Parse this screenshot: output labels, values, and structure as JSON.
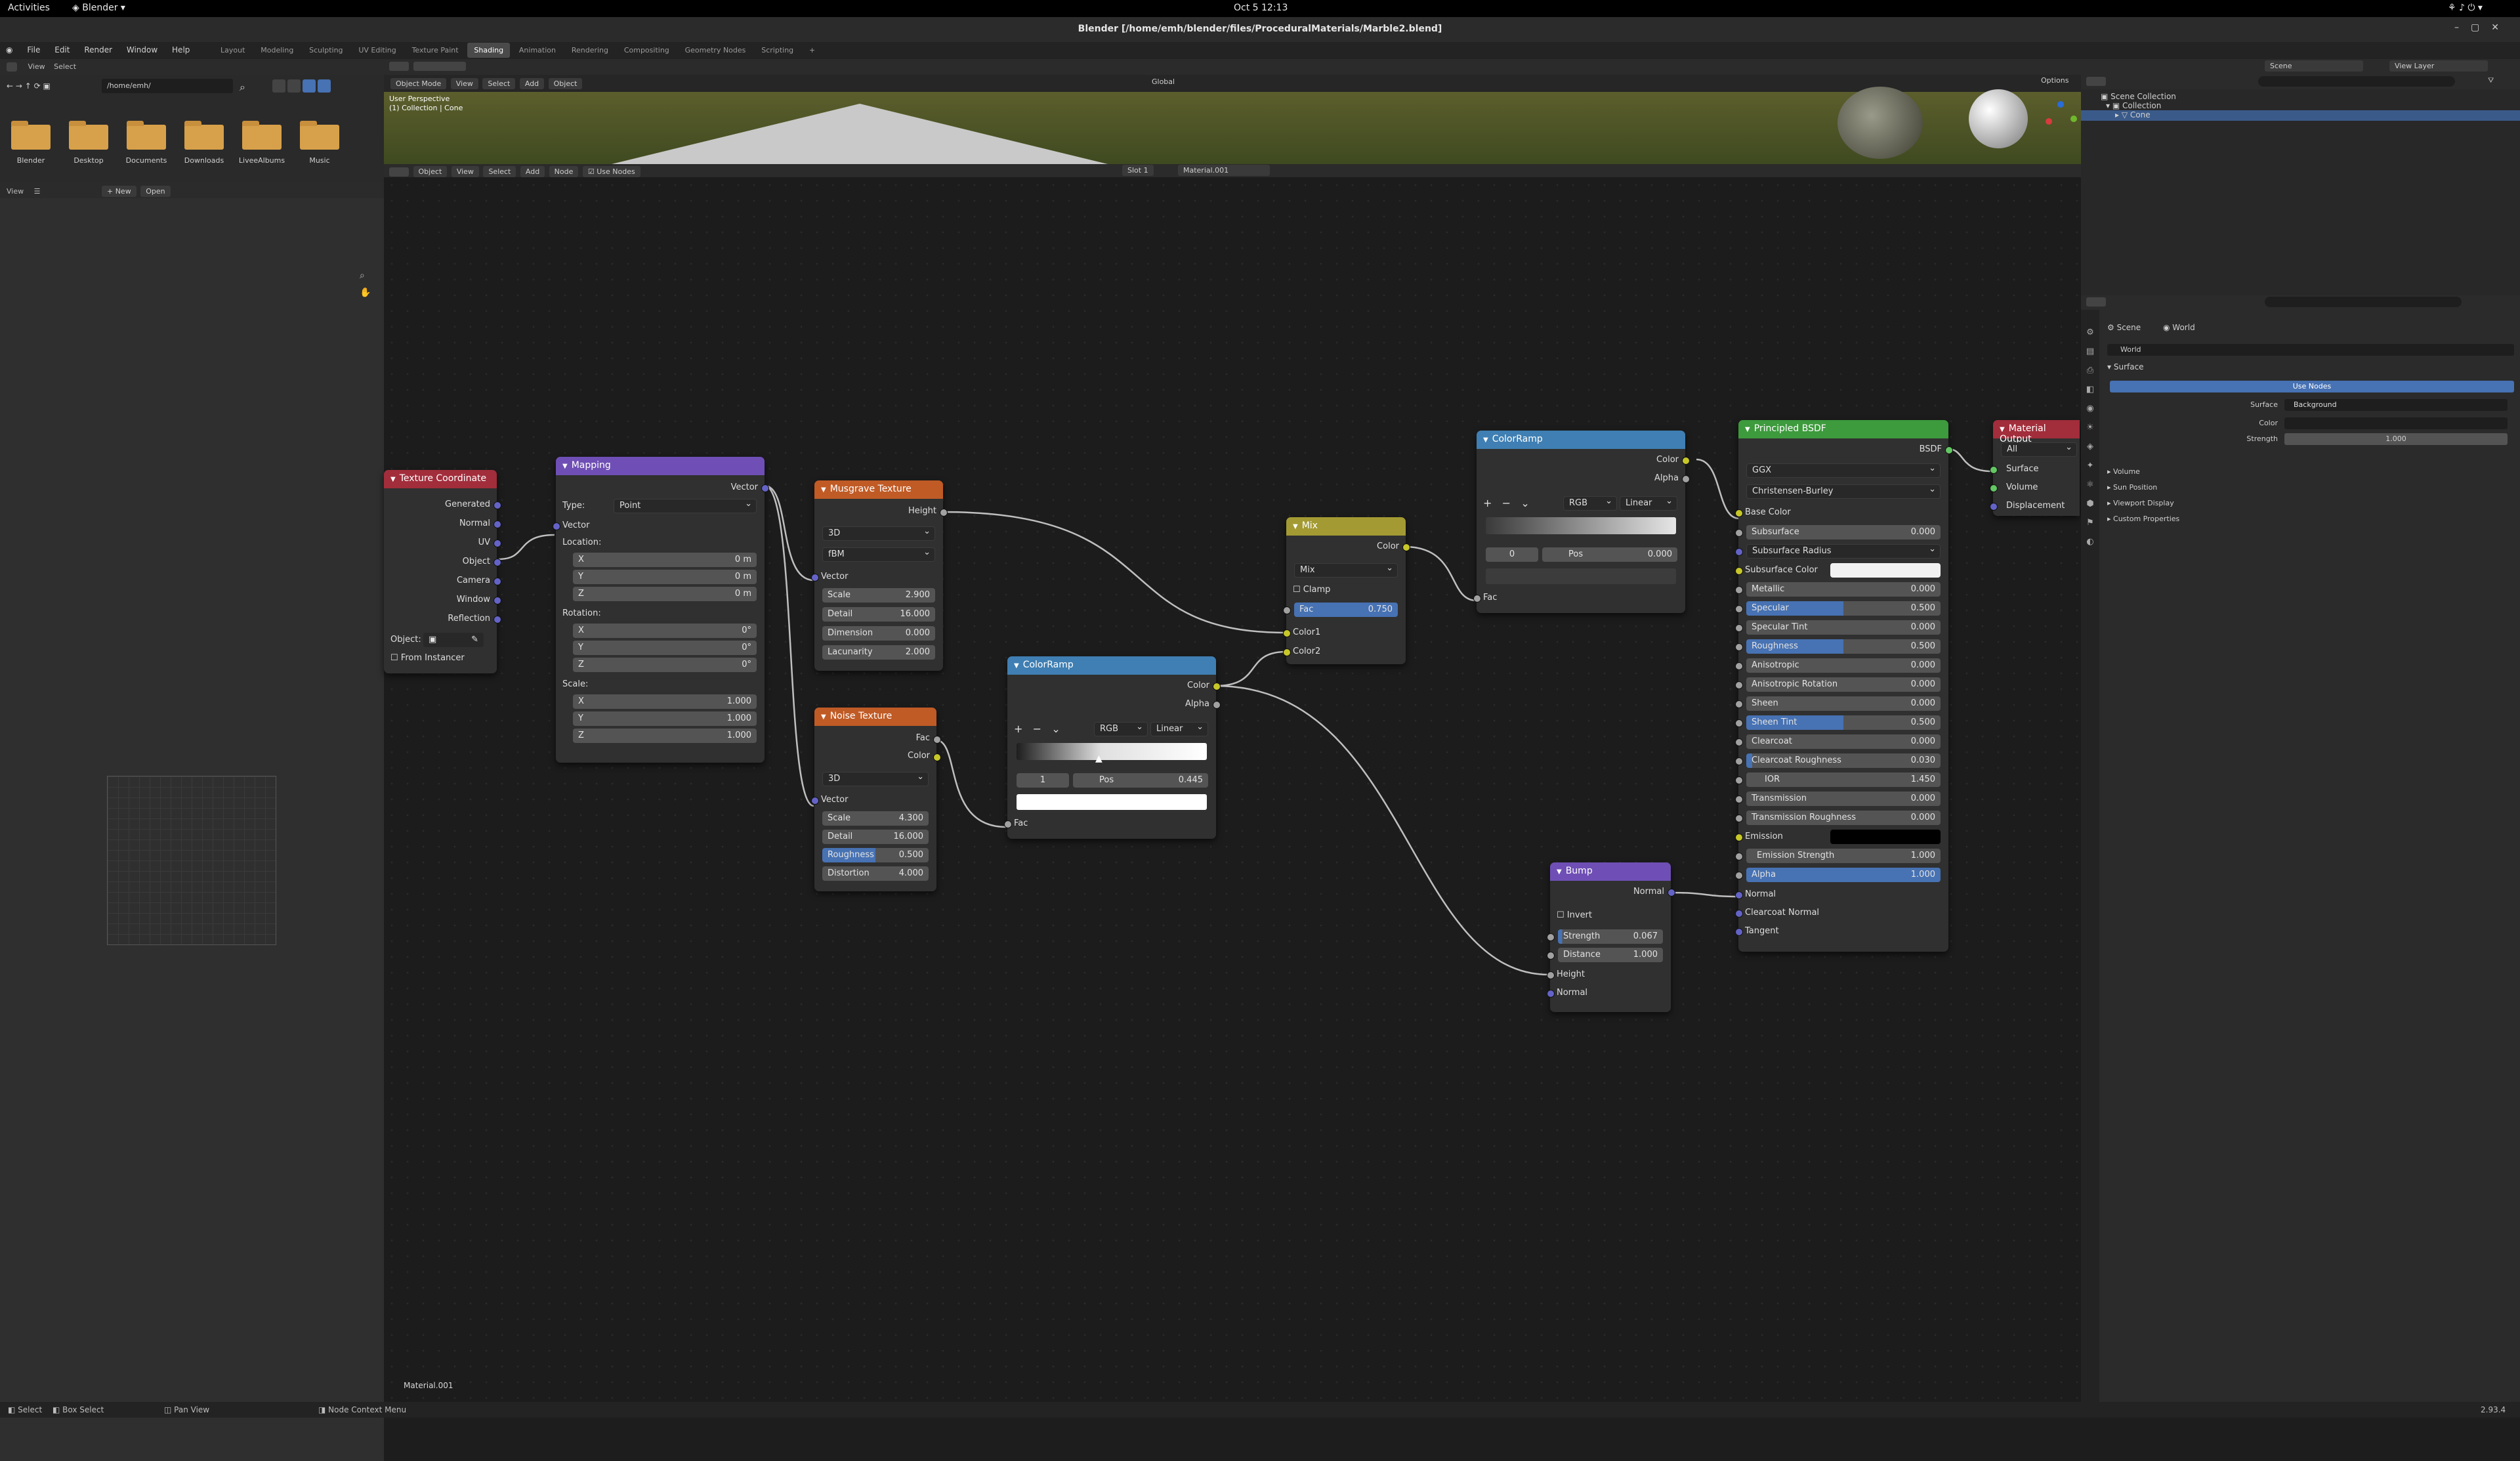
{
  "gnome": {
    "activities": "Activities",
    "app": "Blender",
    "clock": "Oct 5  12:13"
  },
  "window": {
    "title": "Blender [/home/emh/blender/files/ProceduralMaterials/Marble2.blend]"
  },
  "menubar": {
    "items": [
      "File",
      "Edit",
      "Render",
      "Window",
      "Help"
    ],
    "workspaces": [
      "Layout",
      "Modeling",
      "Sculpting",
      "UV Editing",
      "Texture Paint",
      "Shading",
      "Animation",
      "Rendering",
      "Compositing",
      "Geometry Nodes",
      "Scripting"
    ],
    "active_workspace": "Shading"
  },
  "filebrowser": {
    "menus": [
      "View",
      "Select"
    ],
    "path": "/home/emh/",
    "folders": [
      "Blender",
      "Desktop",
      "Documents",
      "Downloads",
      "LiveeAlbums",
      "Music"
    ],
    "bottom_header": {
      "view": "View",
      "new": "New",
      "open": "Open"
    }
  },
  "viewport": {
    "mode": "Object Mode",
    "menus": [
      "View",
      "Select",
      "Add",
      "Object"
    ],
    "orientation": "Global",
    "overlay1": "User Perspective",
    "overlay2": "(1) Collection | Cone",
    "options": "Options"
  },
  "node_header": {
    "object": "Object",
    "menus": [
      "View",
      "Select",
      "Add",
      "Node"
    ],
    "use_nodes": "Use Nodes",
    "slot": "Slot 1",
    "material": "Material.001"
  },
  "node_footer": "Material.001",
  "nodes": {
    "texcoord": {
      "title": "Texture Coordinate",
      "outputs": [
        "Generated",
        "Normal",
        "UV",
        "Object",
        "Camera",
        "Window",
        "Reflection"
      ],
      "object_label": "Object:",
      "from_instancer": "From Instancer"
    },
    "mapping": {
      "title": "Mapping",
      "out": "Vector",
      "type_label": "Type:",
      "type": "Point",
      "vector": "Vector",
      "location": "Location:",
      "loc": [
        [
          "X",
          "0 m"
        ],
        [
          "Y",
          "0 m"
        ],
        [
          "Z",
          "0 m"
        ]
      ],
      "rotation": "Rotation:",
      "rot": [
        [
          "X",
          "0°"
        ],
        [
          "Y",
          "0°"
        ],
        [
          "Z",
          "0°"
        ]
      ],
      "scale_label": "Scale:",
      "scl": [
        [
          "X",
          "1.000"
        ],
        [
          "Y",
          "1.000"
        ],
        [
          "Z",
          "1.000"
        ]
      ]
    },
    "musgrave": {
      "title": "Musgrave Texture",
      "out": "Height",
      "dim": "3D",
      "kind": "fBM",
      "vector": "Vector",
      "fields": [
        [
          "Scale",
          "2.900"
        ],
        [
          "Detail",
          "16.000"
        ],
        [
          "Dimension",
          "0.000"
        ],
        [
          "Lacunarity",
          "2.000"
        ]
      ]
    },
    "noise": {
      "title": "Noise Texture",
      "outs": [
        "Fac",
        "Color"
      ],
      "dim": "3D",
      "vector": "Vector",
      "fields": [
        [
          "Scale",
          "4.300"
        ],
        [
          "Detail",
          "16.000"
        ],
        [
          "Roughness",
          "0.500"
        ],
        [
          "Distortion",
          "4.000"
        ]
      ]
    },
    "ramp1": {
      "title": "ColorRamp",
      "outs": [
        "Color",
        "Alpha"
      ],
      "mode": "RGB",
      "interp": "Linear",
      "index": "1",
      "pos_label": "Pos",
      "pos": "0.445",
      "in": "Fac"
    },
    "mix": {
      "title": "Mix",
      "out": "Color",
      "blend": "Mix",
      "clamp": "Clamp",
      "fac_label": "Fac",
      "fac": "0.750",
      "in1": "Color1",
      "in2": "Color2"
    },
    "ramp2": {
      "title": "ColorRamp",
      "outs": [
        "Color",
        "Alpha"
      ],
      "mode": "RGB",
      "interp": "Linear",
      "index": "0",
      "pos_label": "Pos",
      "pos": "0.000",
      "in": "Fac"
    },
    "bump": {
      "title": "Bump",
      "out": "Normal",
      "invert": "Invert",
      "fields": [
        [
          "Strength",
          "0.067"
        ],
        [
          "Distance",
          "1.000"
        ]
      ],
      "ins": [
        "Height",
        "Normal"
      ]
    },
    "bsdf": {
      "title": "Principled BSDF",
      "out": "BSDF",
      "dist": "GGX",
      "sss": "Christensen-Burley",
      "base": "Base Color",
      "fields": [
        [
          "Subsurface",
          "0.000"
        ],
        [
          "Metallic",
          "0.000"
        ],
        [
          "Specular",
          "0.500"
        ],
        [
          "Specular Tint",
          "0.000"
        ],
        [
          "Roughness",
          "0.500"
        ],
        [
          "Anisotropic",
          "0.000"
        ],
        [
          "Anisotropic Rotation",
          "0.000"
        ],
        [
          "Sheen",
          "0.000"
        ],
        [
          "Sheen Tint",
          "0.500"
        ],
        [
          "Clearcoat",
          "0.000"
        ],
        [
          "Clearcoat Roughness",
          "0.030"
        ],
        [
          "IOR",
          "1.450"
        ],
        [
          "Transmission",
          "0.000"
        ],
        [
          "Transmission Roughness",
          "0.000"
        ]
      ],
      "subsurface_radius": "Subsurface Radius",
      "subsurface_color": "Subsurface Color",
      "emission": "Emission",
      "emission_strength": [
        "Emission Strength",
        "1.000"
      ],
      "alpha": [
        "Alpha",
        "1.000"
      ],
      "normal": "Normal",
      "clearcoat_normal": "Clearcoat Normal",
      "tangent": "Tangent"
    },
    "output": {
      "title": "Material Output",
      "target": "All",
      "ins": [
        "Surface",
        "Volume",
        "Displacement"
      ]
    }
  },
  "outliner": {
    "scene": "Scene",
    "view_layer": "View Layer",
    "items": [
      "Scene Collection",
      "Collection",
      "Cone"
    ]
  },
  "properties": {
    "scene": "Scene",
    "world": "World",
    "world_name": "World",
    "surface": "Surface",
    "use_nodes": "Use Nodes",
    "surface_label": "Surface",
    "surface_value": "Background",
    "color_label": "Color",
    "strength_label": "Strength",
    "strength": "1.000",
    "sections": [
      "Volume",
      "Sun Position",
      "Viewport Display",
      "Custom Properties"
    ]
  },
  "status": {
    "select": "Select",
    "box": "Box Select",
    "pan": "Pan View",
    "ctx": "Node Context Menu",
    "version": "2.93.4"
  }
}
